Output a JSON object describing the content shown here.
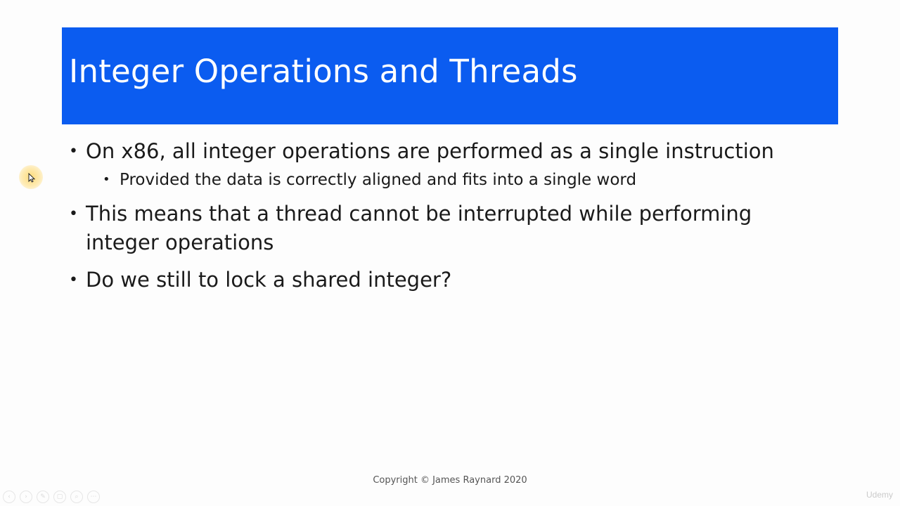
{
  "slide": {
    "title": "Integer Operations and Threads",
    "title_bar_color": "#0b5cf0",
    "bullets": [
      {
        "text": "On x86, all integer operations are performed as a single instruction",
        "sub": [
          "Provided the data is correctly aligned and fits into a single word"
        ]
      },
      {
        "line1": "This means that a thread cannot be interrupted while performing",
        "line2": "integer operations"
      },
      {
        "text": "Do we still to lock a shared integer?"
      }
    ],
    "footer": "Copyright © James Raynard 2020"
  },
  "player": {
    "toolbar_icons": [
      "prev-icon",
      "next-icon",
      "pen-icon",
      "copy-icon",
      "zoom-icon",
      "more-icon"
    ],
    "watermark": "Udemy"
  }
}
